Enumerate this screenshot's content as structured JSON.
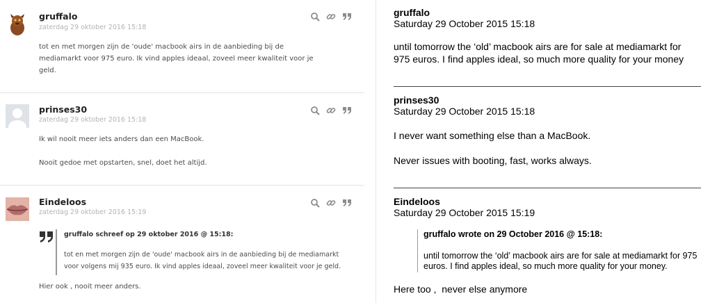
{
  "left_posts": [
    {
      "username": "gruffalo",
      "date": "zaterdag 29 oktober 2016 15:18",
      "avatar": "gruffalo-avatar",
      "lines": [
        "tot en met morgen zijn de 'oude' macbook airs in de aanbieding bij de",
        "mediamarkt voor 975 euro. Ik vind apples ideaal, zoveel meer kwaliteit voor je",
        "geld."
      ]
    },
    {
      "username": "prinses30",
      "date": "zaterdag 29 oktober 2016 15:18",
      "avatar": "default-avatar",
      "lines": [
        "Ik wil nooit meer iets anders dan een MacBook.",
        "Nooit gedoe met opstarten, snel, doet het altijd."
      ]
    },
    {
      "username": "Eindeloos",
      "date": "zaterdag 29 oktober 2016 15:19",
      "avatar": "lips-avatar",
      "quote_header": "gruffalo schreef op 29 oktober 2016 @ 15:18:",
      "quote_lines": [
        "tot en met morgen zijn de 'oude' macbook airs in de aanbieding bij de mediamarkt",
        "voor volgens mij 935 euro. Ik vind apples ideaal, zoveel meer kwaliteit voor je geld."
      ],
      "lines": [
        "Hier ook , nooit meer anders."
      ]
    }
  ],
  "post_icons": [
    "search-icon",
    "link-icon",
    "quote-icon"
  ],
  "right_posts": [
    {
      "username": "gruffalo",
      "date": "Saturday 29 October 2015 15:18",
      "lines": [
        "until tomorrow the ‘old’ macbook airs are for sale at mediamarkt for",
        "975 euros. I find apples ideal, so much more quality for your money"
      ]
    },
    {
      "username": "prinses30",
      "date": "Saturday 29 October 2015 15:18",
      "lines": [
        "I never want something else than a MacBook.",
        "Never issues with booting, fast, works always."
      ]
    },
    {
      "username": "Eindeloos",
      "date": "Saturday 29 October 2015 15:19",
      "quote_header": "gruffalo wrote on 29 October 2016 @ 15:18:",
      "quote_lines": [
        "until tomorrow the ‘old’ macbook airs are for sale at mediamarkt for 975",
        "euros. I find apples ideal, so much more quality for your money."
      ],
      "lines": [
        "Here too ,  never else anymore"
      ]
    }
  ],
  "colors": {
    "icon": "#8c8c8c",
    "date": "#b3b3b3",
    "body_text": "#4a4a4a",
    "rule": "#444444"
  }
}
